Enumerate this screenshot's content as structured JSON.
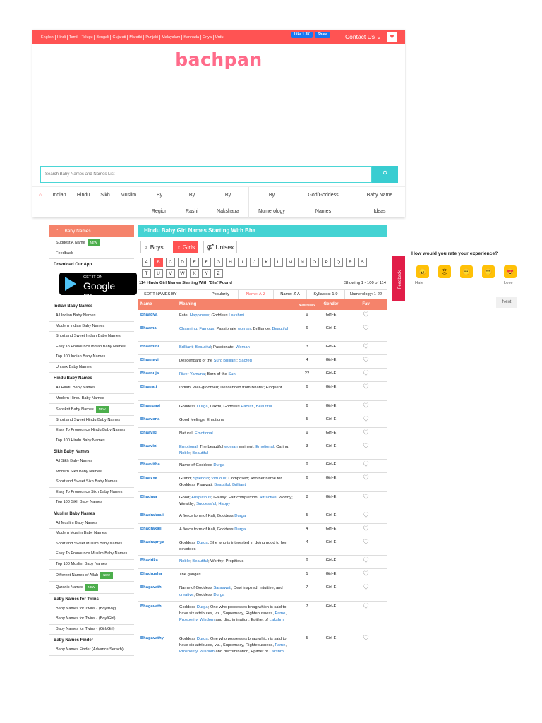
{
  "languages": [
    "English",
    "Hindi",
    "Tamil",
    "Telugu",
    "Bengali",
    "Gujarati",
    "Marathi",
    "Punjabi",
    "Malayalam",
    "Kannada",
    "Oriya",
    "Urdu"
  ],
  "facebook": {
    "like_label": "Like 1.3K",
    "share_label": "Share"
  },
  "contact_label": "Contact Us",
  "logo_text": "bachpan",
  "search": {
    "placeholder": "Search Baby Names and Names List"
  },
  "nav": {
    "home_icon": "⌂",
    "items": [
      "Indian",
      "Hindu",
      "Sikh",
      "Muslim"
    ],
    "by_region": {
      "top": "By",
      "bottom": "Region"
    },
    "by_rashi": {
      "top": "By",
      "bottom": "Rashi"
    },
    "by_nakshatra": {
      "top": "By",
      "bottom": "Nakshatra"
    },
    "by_numerology": {
      "top": "By",
      "bottom": "Numerology"
    },
    "god_goddess": {
      "top": "God/Goddess",
      "bottom": "Names"
    },
    "baby_name_ideas": {
      "top": "Baby Name",
      "bottom": "Ideas"
    }
  },
  "sidebar": {
    "header": "Baby Names",
    "suggest": "Suggest A Name",
    "new_badge": "NEW",
    "feedback": "Feedback",
    "download_app": "Download Our App",
    "google_play": {
      "line1": "GET IT ON",
      "line2": "Google Play"
    },
    "sections": [
      {
        "title": "Indian Baby Names",
        "items": [
          "All Indian Baby Names",
          "Modern Indian Baby Names",
          "Short and Sweet Indian Baby Names",
          "Easy To Pronounce Indian Baby Names",
          "Top 100 Indian Baby Names",
          "Unisex Baby Names"
        ]
      },
      {
        "title": "Hindu Baby Names",
        "items": [
          "All Hindu Baby Names",
          "Modern Hindu Baby Names",
          "Sanskrit Baby Names",
          "Short and Sweet Hindu Baby Names",
          "Easy To Pronounce Hindu Baby Names",
          "Top 100 Hindu Baby Names"
        ]
      },
      {
        "title": "Sikh Baby Names",
        "items": [
          "All Sikh Baby Names",
          "Modern Sikh Baby Names",
          "Short and Sweet Sikh Baby Names",
          "Easy To Pronounce Sikh Baby Names",
          "Top 100 Sikh Baby Names"
        ]
      },
      {
        "title": "Muslim Baby Names",
        "items": [
          "All Muslim Baby Names",
          "Modern Muslim Baby Names",
          "Short and Sweet Muslim Baby Names",
          "Easy To Pronounce Muslim Baby Names",
          "Top 100 Muslim Baby Names",
          "Different Names of Allah",
          "Quranic Names"
        ]
      },
      {
        "title": "Baby Names for Twins",
        "items": [
          "Baby Names for Twins - (Boy/Boy)",
          "Baby Names for Twins - (Boy/Girl)",
          "Baby Names for Twins - (Girl/Girl)"
        ]
      },
      {
        "title": "Baby Names Finder",
        "items": [
          "Baby Names Finder (Advance Serach)"
        ]
      }
    ]
  },
  "main": {
    "title": "Hindu Baby Girl Names Starting With Bha",
    "tabs": {
      "boys": "♂ Boys",
      "girls": "♀ Girls",
      "unisex": "⚤ Unisex"
    },
    "letters": [
      "A",
      "B",
      "C",
      "D",
      "E",
      "F",
      "G",
      "H",
      "I",
      "J",
      "K",
      "L",
      "M",
      "N",
      "O",
      "P",
      "Q",
      "R",
      "S",
      "T",
      "U",
      "V",
      "W",
      "X",
      "Y",
      "Z"
    ],
    "active_letter": "B",
    "found_text": "114 Hindu Girl Names Starting With 'Bha' Found",
    "showing_text": "Showing 1 - 100 of 114",
    "sort": {
      "label": "SORT NAMES BY",
      "popularity": "Popularity",
      "name_az": "Name: A-Z",
      "name_za": "Name: Z-A",
      "syllables": "Syllables: 1-9",
      "numerology": "Numerology: 1-22"
    },
    "columns": {
      "name": "Name",
      "meaning": "Meaning",
      "numerology": "Numerology",
      "gender": "Gender",
      "fav": "Fav"
    },
    "rows": [
      {
        "name": "Bhaagya",
        "meaning": "Fate; Happiness; Goddess Lakshmi",
        "num": "9",
        "gender": "Girl-E"
      },
      {
        "name": "Bhaama",
        "meaning": "Charming; Famous; Passionate woman; Brilliance; Beautiful",
        "num": "6",
        "gender": "Girl-E"
      },
      {
        "name": "Bhaamini",
        "meaning": "Brilliant; Beautiful; Passionate; Woman",
        "num": "3",
        "gender": "Girl-E"
      },
      {
        "name": "Bhaanavi",
        "meaning": "Descendant of the Sun; Brilliant; Sacred",
        "num": "4",
        "gender": "Girl-E"
      },
      {
        "name": "Bhaanuja",
        "meaning": "River Yamuna; Born of the Sun",
        "num": "22",
        "gender": "Girl-E"
      },
      {
        "name": "Bhaarati",
        "meaning": "Indian; Well-groomed; Descended from Bharat; Eloquent",
        "num": "6",
        "gender": "Girl-E"
      },
      {
        "name": "Bhaargavi",
        "meaning": "Goddess Durga, Laxmi, Goddess Parvati, Beautiful",
        "num": "6",
        "gender": "Girl-E"
      },
      {
        "name": "Bhaavana",
        "meaning": "Good feelings; Emotions",
        "num": "5",
        "gender": "Girl-E"
      },
      {
        "name": "Bhaaviki",
        "meaning": "Natural; Emotional",
        "num": "9",
        "gender": "Girl-E"
      },
      {
        "name": "Bhaavini",
        "meaning": "Emotional; The beautiful woman eminent; Emotional; Caring; Noble; Beautiful",
        "num": "3",
        "gender": "Girl-E"
      },
      {
        "name": "Bhaavitha",
        "meaning": "Name of Goddess Durga",
        "num": "9",
        "gender": "Girl-E"
      },
      {
        "name": "Bhaavya",
        "meaning": "Grand; Splendid; Virtuous; Composed; Another name for Goddess Paarvati; Beautiful; Brilliant",
        "num": "6",
        "gender": "Girl-E"
      },
      {
        "name": "Bhadraa",
        "meaning": "Good; Auspicious; Galaxy; Fair complexion; Attractive; Worthy; Wealthy; Successful; Happy",
        "num": "8",
        "gender": "Girl-E"
      },
      {
        "name": "Bhadrakaali",
        "meaning": "A fierce form of Kali, Goddess Durga",
        "num": "5",
        "gender": "Girl-E"
      },
      {
        "name": "Bhadrakali",
        "meaning": "A fierce form of Kali, Goddess Durga",
        "num": "4",
        "gender": "Girl-E"
      },
      {
        "name": "Bhadrapriya",
        "meaning": "Goddess Durga, She who is interested in doing good to her devotees",
        "num": "4",
        "gender": "Girl-E"
      },
      {
        "name": "Bhadrika",
        "meaning": "Noble; Beautiful; Worthy; Propitious",
        "num": "9",
        "gender": "Girl-E"
      },
      {
        "name": "Bhadrusha",
        "meaning": "The ganges",
        "num": "1",
        "gender": "Girl-E"
      },
      {
        "name": "Bhagavath",
        "meaning": "Name of Goddess Saraswati; Devi inspired; Intuitive, and creative; Goddess Durga",
        "num": "7",
        "gender": "Girl-E"
      },
      {
        "name": "Bhagavathi",
        "meaning": "Goddess Durga; One who possesses bhag which is said to have six attributes, viz., Supremacy, Righteousness, Fame, Prosperity, Wisdom and discrimination, Epithet of Lakshmi",
        "num": "7",
        "gender": "Girl-E"
      },
      {
        "name": "Bhagavathy",
        "meaning": "Goddess Durga; One who possesses bhag which is said to have six attributes, viz., Supremacy, Righteousness, Fame, Prosperity, Wisdom and discrimination, Epithet of Lakshmi",
        "num": "5",
        "gender": "Girl-E"
      }
    ]
  },
  "feedback_tab": "Feedback",
  "rating": {
    "question": "How would you rate your experience?",
    "faces": [
      "😠",
      "☹",
      "😐",
      "🙂",
      "😍"
    ],
    "hate": "Hate",
    "love": "Love",
    "next": "Next"
  }
}
